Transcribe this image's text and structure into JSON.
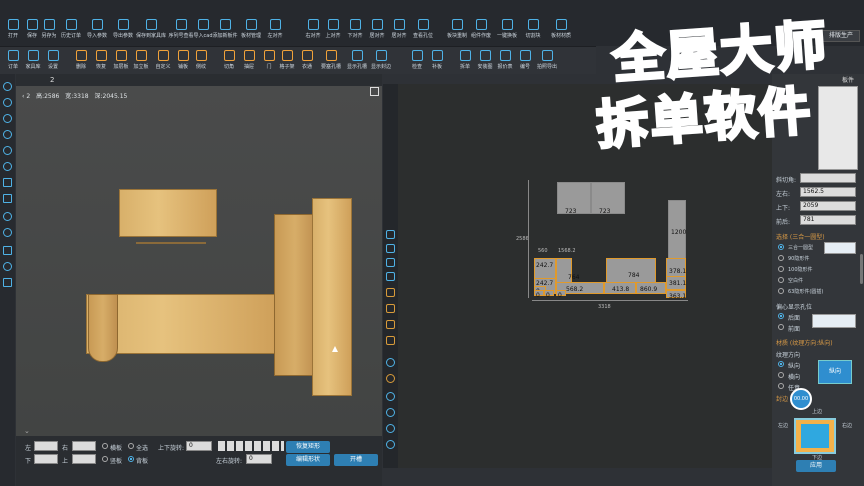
{
  "toolbar": {
    "items": [
      "打开",
      "保存",
      "另存为",
      "历史订单",
      "导入参数",
      "导出参数",
      "保存到家具库",
      "序列号查看",
      "导入cad",
      "添加新板件",
      "板材管理",
      "左对齐",
      "右对齐",
      "上对齐",
      "下对齐",
      "居对齐",
      "居对齐",
      "查看孔位",
      "板块重制",
      "组件作废",
      "一键换板",
      "切割块",
      "板材材质"
    ],
    "right_button": "排版生产"
  },
  "toolbar2": {
    "items": [
      "订单",
      "家具库",
      "设置",
      "删除",
      "恢复",
      "加层板",
      "加立板",
      "自定义",
      "铺板",
      "侧纹",
      "切角",
      "抽屉",
      "门",
      "格子架",
      "衣通",
      "要塞孔槽",
      "显示孔槽",
      "显示封边",
      "检查",
      "补板",
      "拆单",
      "安装图",
      "报价表",
      "编号",
      "拍照导出"
    ]
  },
  "tabs": {
    "tab_number": "2"
  },
  "viewport_info": {
    "index": "2",
    "height": "高:2586",
    "width": "宽:3318",
    "depth": "深:2045.15"
  },
  "watermark": {
    "line1": "全屋大师",
    "line2": "拆单软件"
  },
  "elevation": {
    "cells": [
      "723",
      "723",
      "1200",
      "242.7",
      "764",
      "784",
      "378.1",
      "242.7",
      "381.1",
      "0",
      "568.2",
      "413.8",
      "860.9",
      "0",
      "0",
      "0",
      "363.1"
    ],
    "dims": [
      "2586",
      "560",
      "1568.2",
      "3318"
    ]
  },
  "bottom": {
    "labels": [
      "左",
      "右",
      "下",
      "上",
      "横板",
      "竖板",
      "全选",
      "背板",
      "上下旋转:",
      "左右旋转:"
    ],
    "rot_ud": "0",
    "rot_lr": "0",
    "btn_restore": "恢复矩形",
    "btn_edit": "编辑形状",
    "btn_open": "开槽"
  },
  "right": {
    "header": "板件",
    "angle_label": "斜切角:",
    "left_label": "左右:",
    "left_val": "1562.5",
    "updown_label": "上下:",
    "updown_val": "2059",
    "front_label": "前后:",
    "front_val": "781",
    "choose_section": "选择 (三合一圆型)",
    "options": [
      "三合一圆型",
      "90隐形件",
      "100隐形件",
      "空白件",
      "63隐形件(圆插)"
    ],
    "hole_title": "偏心显示孔位",
    "hole_opts": [
      "后面",
      "前面"
    ],
    "texture_section": "材质 (纹理方向:纵向)",
    "grain_title": "纹理方向",
    "grain_opts": [
      "纵向",
      "横向",
      "任意"
    ],
    "grain_btn": "纵向",
    "edge_title": "封边",
    "edge_val": "00.00",
    "apply_btn": "应用",
    "side_labels": [
      "上边",
      "左边",
      "右边",
      "下边"
    ]
  }
}
